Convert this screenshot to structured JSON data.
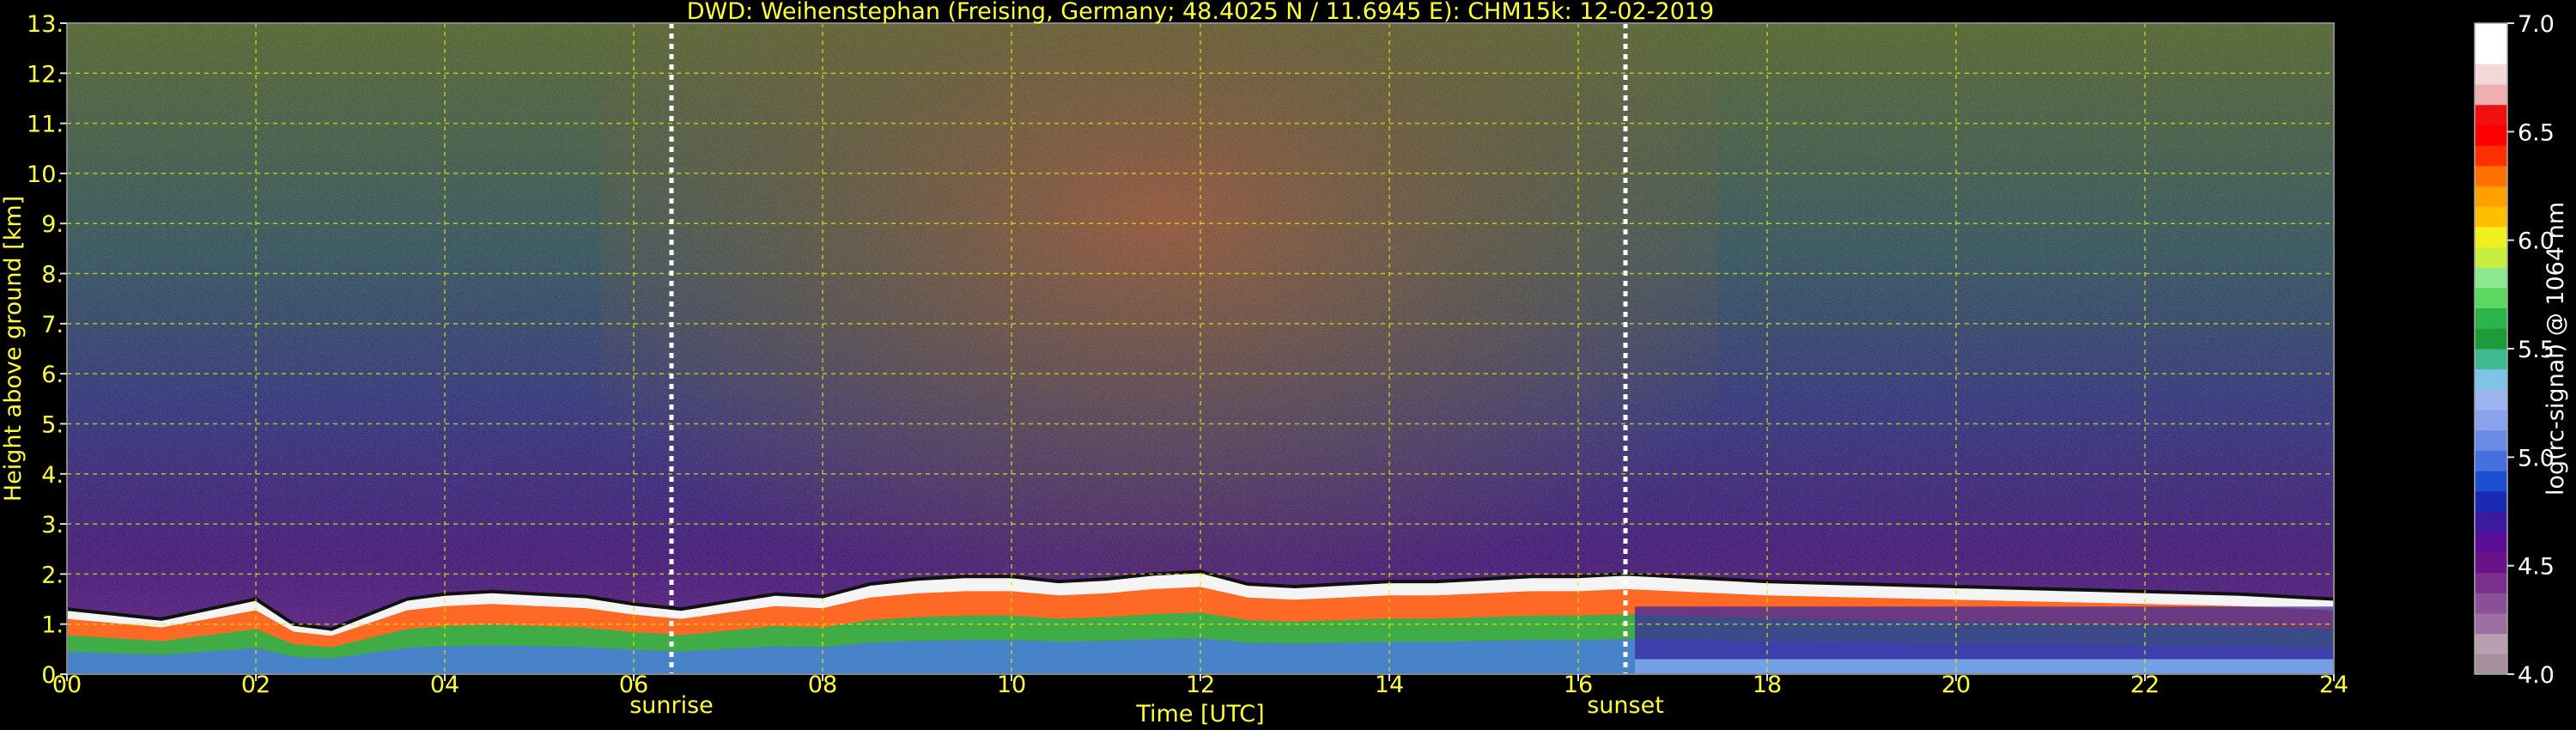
{
  "chart_data": {
    "type": "heatmap",
    "title": "DWD: Weihenstephan (Freising, Germany; 48.4025 N / 11.6945 E):    CHM15k: 12-02-2019",
    "xlabel": "Time [UTC]",
    "ylabel": "Height above ground [km]",
    "xlim": [
      0,
      24
    ],
    "ylim": [
      0,
      13
    ],
    "x_ticks": [
      "00",
      "02",
      "04",
      "06",
      "08",
      "10",
      "12",
      "14",
      "16",
      "18",
      "20",
      "22",
      "24"
    ],
    "y_ticks": [
      "0.",
      "1.",
      "2.",
      "3.",
      "4.",
      "5.",
      "6.",
      "7.",
      "8.",
      "9.",
      "10.",
      "11.",
      "12.",
      "13."
    ],
    "grid": true,
    "events": [
      {
        "label": "sunrise",
        "time": 6.4
      },
      {
        "label": "sunset",
        "time": 16.5
      }
    ],
    "boundary_layer_top_km": [
      {
        "t": 0.0,
        "h": 1.3
      },
      {
        "t": 0.5,
        "h": 1.2
      },
      {
        "t": 1.0,
        "h": 1.1
      },
      {
        "t": 1.5,
        "h": 1.3
      },
      {
        "t": 2.0,
        "h": 1.5
      },
      {
        "t": 2.4,
        "h": 1.0
      },
      {
        "t": 2.8,
        "h": 0.9
      },
      {
        "t": 3.2,
        "h": 1.2
      },
      {
        "t": 3.6,
        "h": 1.5
      },
      {
        "t": 4.0,
        "h": 1.6
      },
      {
        "t": 4.5,
        "h": 1.65
      },
      {
        "t": 5.0,
        "h": 1.6
      },
      {
        "t": 5.5,
        "h": 1.55
      },
      {
        "t": 6.0,
        "h": 1.4
      },
      {
        "t": 6.5,
        "h": 1.3
      },
      {
        "t": 7.0,
        "h": 1.45
      },
      {
        "t": 7.5,
        "h": 1.6
      },
      {
        "t": 8.0,
        "h": 1.55
      },
      {
        "t": 8.5,
        "h": 1.8
      },
      {
        "t": 9.0,
        "h": 1.9
      },
      {
        "t": 9.5,
        "h": 1.95
      },
      {
        "t": 10.0,
        "h": 1.95
      },
      {
        "t": 10.5,
        "h": 1.85
      },
      {
        "t": 11.0,
        "h": 1.9
      },
      {
        "t": 11.5,
        "h": 2.0
      },
      {
        "t": 12.0,
        "h": 2.05
      },
      {
        "t": 12.5,
        "h": 1.8
      },
      {
        "t": 13.0,
        "h": 1.75
      },
      {
        "t": 13.5,
        "h": 1.8
      },
      {
        "t": 14.0,
        "h": 1.85
      },
      {
        "t": 14.5,
        "h": 1.85
      },
      {
        "t": 15.0,
        "h": 1.9
      },
      {
        "t": 15.5,
        "h": 1.95
      },
      {
        "t": 16.0,
        "h": 1.95
      },
      {
        "t": 16.5,
        "h": 2.0
      },
      {
        "t": 17.0,
        "h": 1.95
      },
      {
        "t": 18.0,
        "h": 1.85
      },
      {
        "t": 19.0,
        "h": 1.8
      },
      {
        "t": 20.0,
        "h": 1.75
      },
      {
        "t": 21.0,
        "h": 1.7
      },
      {
        "t": 22.0,
        "h": 1.65
      },
      {
        "t": 23.0,
        "h": 1.6
      },
      {
        "t": 24.0,
        "h": 1.5
      }
    ],
    "colorbar": {
      "label": "log(rc-signal) @ 1064 nm",
      "range": [
        4.0,
        7.0
      ],
      "ticks": [
        "4.0",
        "4.5",
        "5.0",
        "5.5",
        "6.0",
        "6.5",
        "7.0"
      ],
      "colors": [
        "#a48f9a",
        "#b8a0b0",
        "#9b6fa0",
        "#8a4f96",
        "#7a2f8c",
        "#6a128a",
        "#5a0f96",
        "#3c1aa0",
        "#1a2ab4",
        "#1e4ed0",
        "#4470e0",
        "#6a8ae6",
        "#8aa2ec",
        "#9cb4f0",
        "#7fc4e8",
        "#40b890",
        "#1f9a3a",
        "#2bb44a",
        "#5ad860",
        "#8ee890",
        "#c8ee40",
        "#f0f020",
        "#ffc000",
        "#ffa000",
        "#ff7000",
        "#ff3000",
        "#ff0000",
        "#f01010",
        "#f0b0b0",
        "#f4d8d8",
        "#ffffff",
        "#ffffff"
      ]
    }
  }
}
